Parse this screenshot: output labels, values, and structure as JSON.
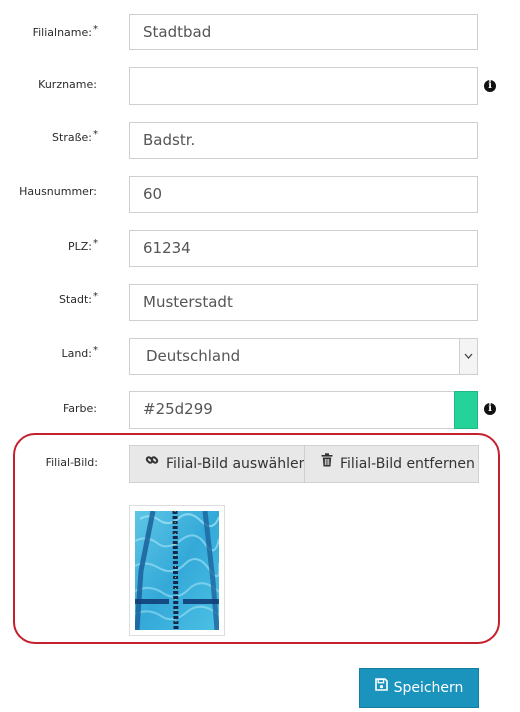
{
  "form": {
    "fields": [
      {
        "label": "Filialname:",
        "required": "*",
        "value": "Stadtbad"
      },
      {
        "label": "Kurzname:",
        "required": "",
        "value": ""
      },
      {
        "label": "Straße:",
        "required": "*",
        "value": "Badstr."
      },
      {
        "label": "Hausnummer:",
        "required": "",
        "value": "60"
      },
      {
        "label": "PLZ:",
        "required": "*",
        "value": "61234"
      },
      {
        "label": "Stadt:",
        "required": "*",
        "value": "Musterstadt"
      },
      {
        "label": "Land:",
        "required": "*",
        "value": "Deutschland"
      },
      {
        "label": "Farbe:",
        "required": "",
        "value": "#25d299"
      }
    ],
    "swatch_color": "#25d299",
    "image": {
      "label": "Filial-Bild:",
      "choose_label": "Filial-Bild auswählen",
      "remove_label": "Filial-Bild entfernen"
    },
    "save_label": "Speichern"
  },
  "icons": {
    "info": "info-circle-icon",
    "link": "link-icon",
    "trash": "trash-icon",
    "save": "floppy-disk-icon",
    "dropdown": "chevron-down-icon"
  },
  "colors": {
    "highlight_frame": "#c5202e",
    "primary_button": "#1a93bd"
  }
}
